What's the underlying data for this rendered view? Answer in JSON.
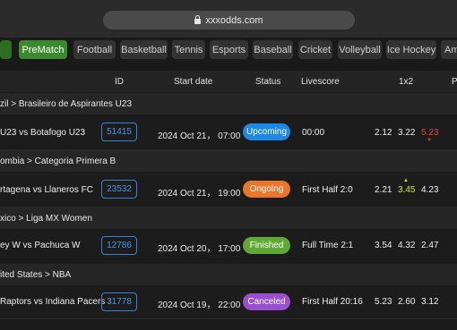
{
  "browser": {
    "url": "xxxodds.com"
  },
  "tabs": [
    "",
    "PreMatch",
    "Football",
    "Basketball",
    "Tennis",
    "Esports",
    "Baseball",
    "Cricket",
    "Volleyball",
    "Ice Hockey",
    "Am"
  ],
  "headers": {
    "id": "ID",
    "start_date": "Start date",
    "status": "Status",
    "livescore": "Livescore",
    "odds": "1x2",
    "extra": "P"
  },
  "groups": [
    {
      "league": "zil > Brasileiro de Aspirantes U23",
      "match": {
        "name": "U23 vs Botafogo U23",
        "id": "51415",
        "start": "2024 Oct 21， 07:00",
        "status": "Upcoming",
        "status_color": "#1e88e5",
        "livescore": "00:00",
        "o1": "2.12",
        "ox": "3.22",
        "o2": "5.23",
        "o2_trend": "down",
        "o2_arrow": "▼"
      }
    },
    {
      "league": "ombia > Categoria Primera B",
      "match": {
        "name": "rtagena vs Llaneros FC",
        "id": "23532",
        "start": "2024 Oct 21， 19:00",
        "status": "Ongoing",
        "status_color": "#e8762b",
        "livescore": "First Half 2:0",
        "o1": "2.21",
        "ox": "3.45",
        "ox_trend": "up",
        "ox_arrow": "▲",
        "o2": "4.23"
      }
    },
    {
      "league": "xico > Liga MX Women",
      "match": {
        "name": "ey W vs Pachuca W",
        "id": "12786",
        "start": "2024 Oct 20， 17:00",
        "status": "Finished",
        "status_color": "#5fa834",
        "livescore": "Full Time 2:1",
        "o1": "3.54",
        "ox": "4.32",
        "o2": "2.47"
      }
    },
    {
      "league": "ited States > NBA",
      "match": {
        "name": "Raptors vs Indiana Pacers",
        "id": "31778",
        "start": "2024 Oct 19， 22:00",
        "status": "Canceled",
        "status_color": "#9a4fd1",
        "livescore": "First Half 20:16",
        "o1": "5.23",
        "ox": "2.60",
        "o2": "3.12"
      }
    }
  ]
}
